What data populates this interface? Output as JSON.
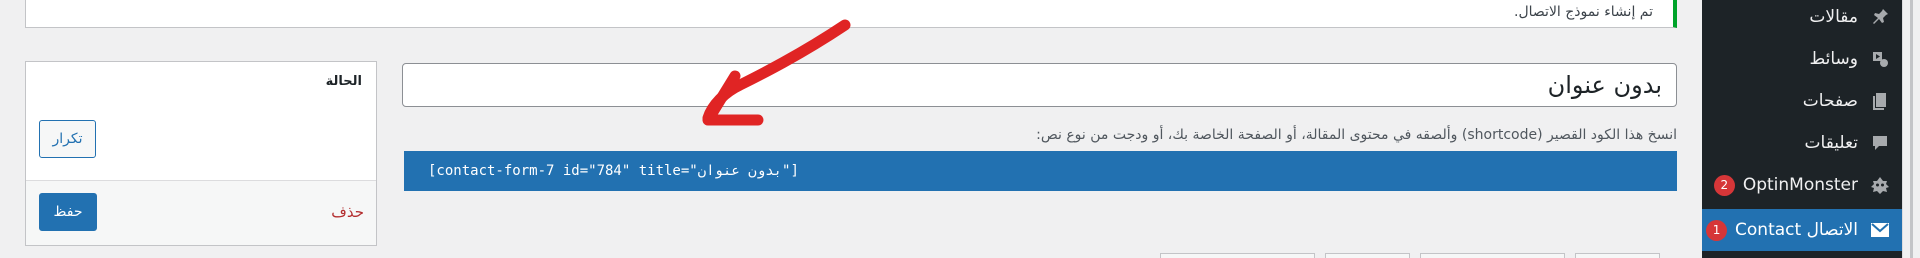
{
  "notice": {
    "text": "تم إنشاء نموذج الاتصال."
  },
  "sidebar": {
    "items": [
      {
        "label": "مقالات",
        "icon": "pin-icon"
      },
      {
        "label": "وسائط",
        "icon": "media-icon"
      },
      {
        "label": "صفحات",
        "icon": "pages-icon"
      },
      {
        "label": "تعليقات",
        "icon": "comments-icon"
      },
      {
        "label": "OptinMonster",
        "icon": "optinmonster-icon",
        "badge": "2"
      },
      {
        "label": "الاتصال Contact",
        "icon": "mail-icon",
        "badge": "1",
        "current": true
      }
    ]
  },
  "form": {
    "title_value": "بدون عنوان",
    "shortcode_hint": "انسخ هذا الكود القصير (shortcode) وألصقه في محتوى المقالة، أو الصفحة الخاصة بك، أو ودجت من نوع نص:",
    "shortcode": "[contact-form-7 id=\"784\" title=\"بدون عنوان\"]"
  },
  "status_box": {
    "title": "الحالة",
    "duplicate_label": "تكرار",
    "save_label": "حفظ",
    "delete_label": "حذف"
  },
  "colors": {
    "sidebar_bg": "#1d2327",
    "accent": "#2271b1",
    "notice_success": "#00a32a",
    "badge": "#d63638",
    "delete": "#b32d2e",
    "annotation_arrow": "#e02424"
  }
}
